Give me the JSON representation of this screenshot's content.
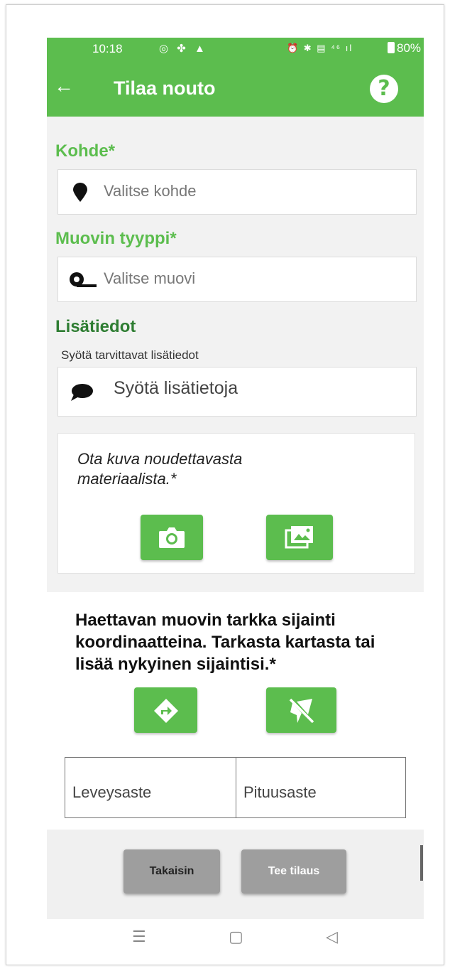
{
  "status_bar": {
    "time": "10:18",
    "left_icons": "◎ ✤ ▲",
    "right_icons": "⏰ ✱ ▤ ⁴⁶ ıl",
    "battery": "80%"
  },
  "app_bar": {
    "title": "Tilaa nouto",
    "back_icon": "arrow-left-icon",
    "help_icon": "help-icon",
    "help_glyph": "?",
    "back_glyph": "←",
    "color": "#5cbd4e"
  },
  "form": {
    "destination": {
      "label": "Kohde*",
      "placeholder": "Valitse kohde",
      "icon": "map-pin-icon"
    },
    "plastic_type": {
      "label": "Muovin tyyppi*",
      "placeholder": "Valitse muovi",
      "icon": "plastic-roll-icon"
    },
    "additional_info": {
      "label": "Lisätiedot",
      "hint": "Syötä tarvittavat lisätiedot",
      "placeholder": "Syötä lisätietoja",
      "icon": "chat-bubble-icon"
    },
    "photo": {
      "instruction": "Ota kuva noudettavasta materiaalista.*",
      "camera_icon": "camera-icon",
      "gallery_icon": "gallery-icon"
    },
    "location": {
      "instruction": "Haettavan muovin tarkka sijainti koordinaatteina. Tarkasta kartasta tai lisää nykyinen sijaintisi.*",
      "map_icon": "directions-icon",
      "current_location_icon": "location-off-icon",
      "latitude_placeholder": "Leveysaste",
      "longitude_placeholder": "Pituusaste"
    }
  },
  "actions": {
    "back_label": "Takaisin",
    "submit_label": "Tee tilaus"
  },
  "nav": {
    "menu_glyph": "☰",
    "home_glyph": "▢",
    "back_glyph": "◁"
  }
}
